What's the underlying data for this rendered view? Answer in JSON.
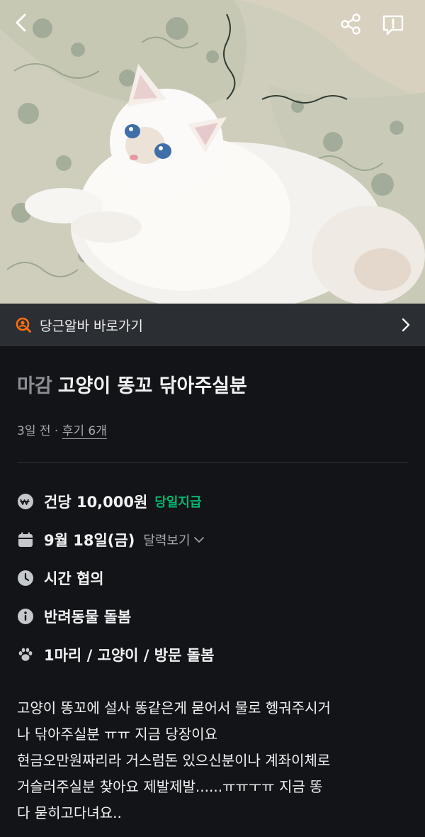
{
  "photo": {
    "subject": "white-cat-on-floral-bedding"
  },
  "topbar": {
    "back_icon": "chevron-left-icon",
    "share_icon": "share-icon",
    "report_icon": "report-icon"
  },
  "banner": {
    "label": "당근알바 바로가기",
    "icon": "search-person-icon",
    "accent": "#ff6f0f"
  },
  "post": {
    "status": "마감",
    "title": "고양이 똥꼬 닦아주실분",
    "posted": "3일 전",
    "separator": "·",
    "reviews": "후기 6개"
  },
  "details": {
    "pay": "건당 10,000원",
    "pay_tag": "당일지급",
    "pay_tag_color": "#00b872",
    "date": "9월 18일(금)",
    "calendar_link": "달력보기",
    "time": "시간 협의",
    "category": "반려동물 돌봄",
    "pet": "1마리 / 고양이 / 방문 돌봄"
  },
  "description": [
    "고양이 똥꼬에 설사 똥같은게 묻어서 물로 헹궈주시거",
    "나 닦아주실분 ㅠㅠ 지금 당장이요",
    "현금오만원짜리라 거스럼돈 있으신분이나 계좌이체로",
    "거슬러주실분 찾아요 제발제발......ㅠㅠㅜㅠ 지금 똥",
    "다 묻히고다녀요.."
  ]
}
